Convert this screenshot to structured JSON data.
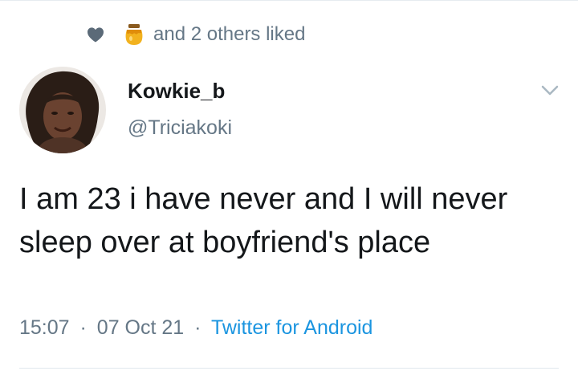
{
  "social_context": {
    "icon": "heart-icon",
    "liker_avatar": "honey-pot-avatar",
    "text": "and 2 others liked"
  },
  "author": {
    "display_name": "Kowkie_b",
    "username": "@Triciakoki",
    "avatar": "profile-photo"
  },
  "tweet": {
    "text": "I am 23 i have never and I will never sleep over at boyfriend's place"
  },
  "meta": {
    "time": "15:07",
    "separator": "·",
    "date": "07 Oct 21",
    "source": "Twitter for Android"
  },
  "colors": {
    "text_primary": "#14171a",
    "text_secondary": "#657786",
    "link": "#1b95e0",
    "divider": "#e1e8ed"
  }
}
